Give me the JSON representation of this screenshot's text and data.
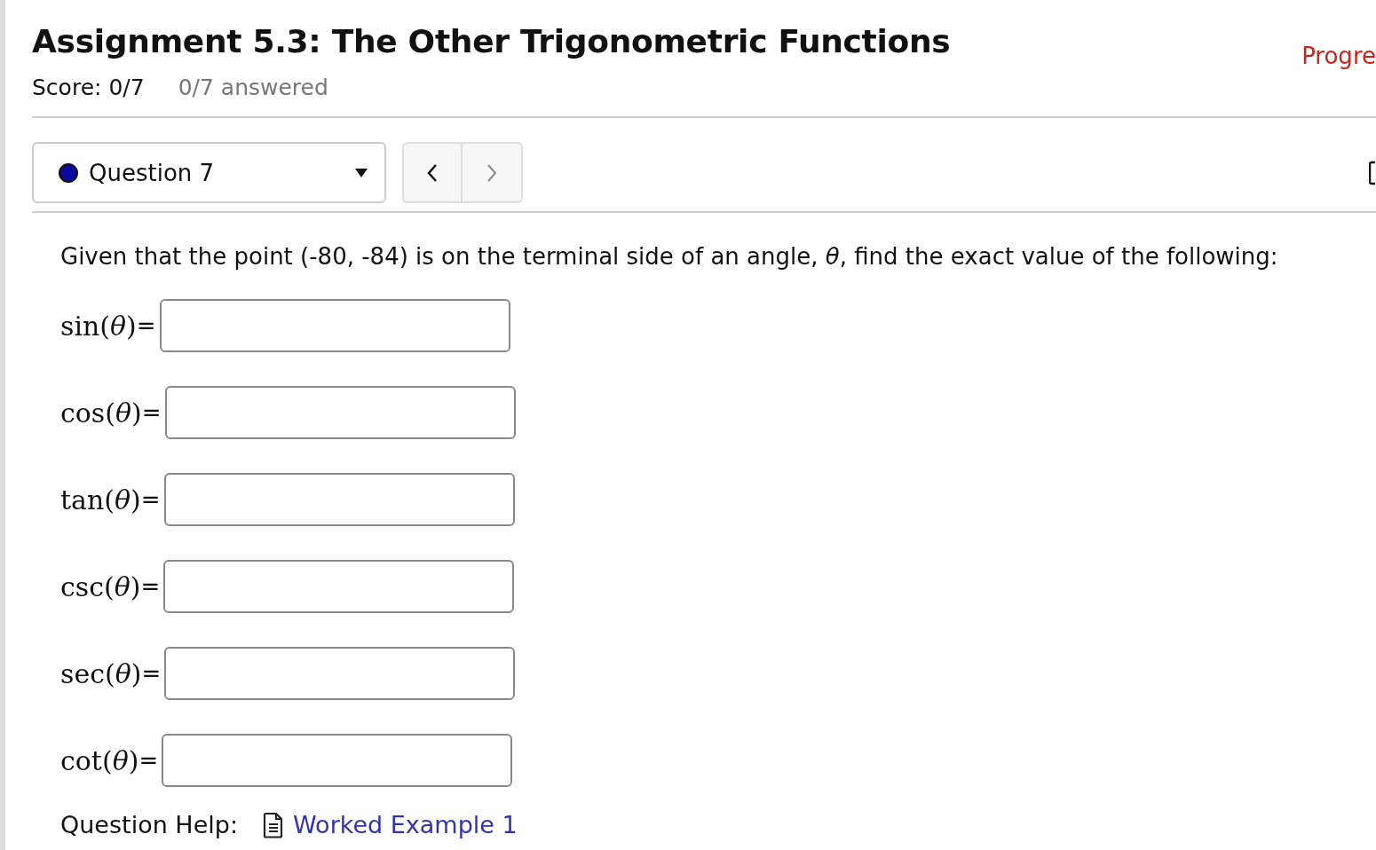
{
  "assignment": {
    "title": "Assignment 5.3: The Other Trigonometric Functions",
    "score": "Score: 0/7",
    "answered": "0/7 answered",
    "progress": "Progre"
  },
  "question_select": {
    "label": "Question 7",
    "color": "#0a0aa0"
  },
  "nav": {
    "prev_disabled": false,
    "next_disabled": true
  },
  "question": {
    "prompt": "Given that the point (-80, -84) is on the terminal side of an angle, *θ*, find the exact value of the following:",
    "answers": [
      {
        "label": "sin(*θ*)"
      },
      {
        "label": "cos(*θ*)"
      },
      {
        "label": "tan(*θ*)"
      },
      {
        "label": "csc(*θ*)"
      },
      {
        "label": "sec(*θ*)"
      },
      {
        "label": "cot(*θ*)"
      }
    ],
    "equals": "=",
    "help_label": "Question Help:",
    "help_link": "Worked Example 1"
  }
}
